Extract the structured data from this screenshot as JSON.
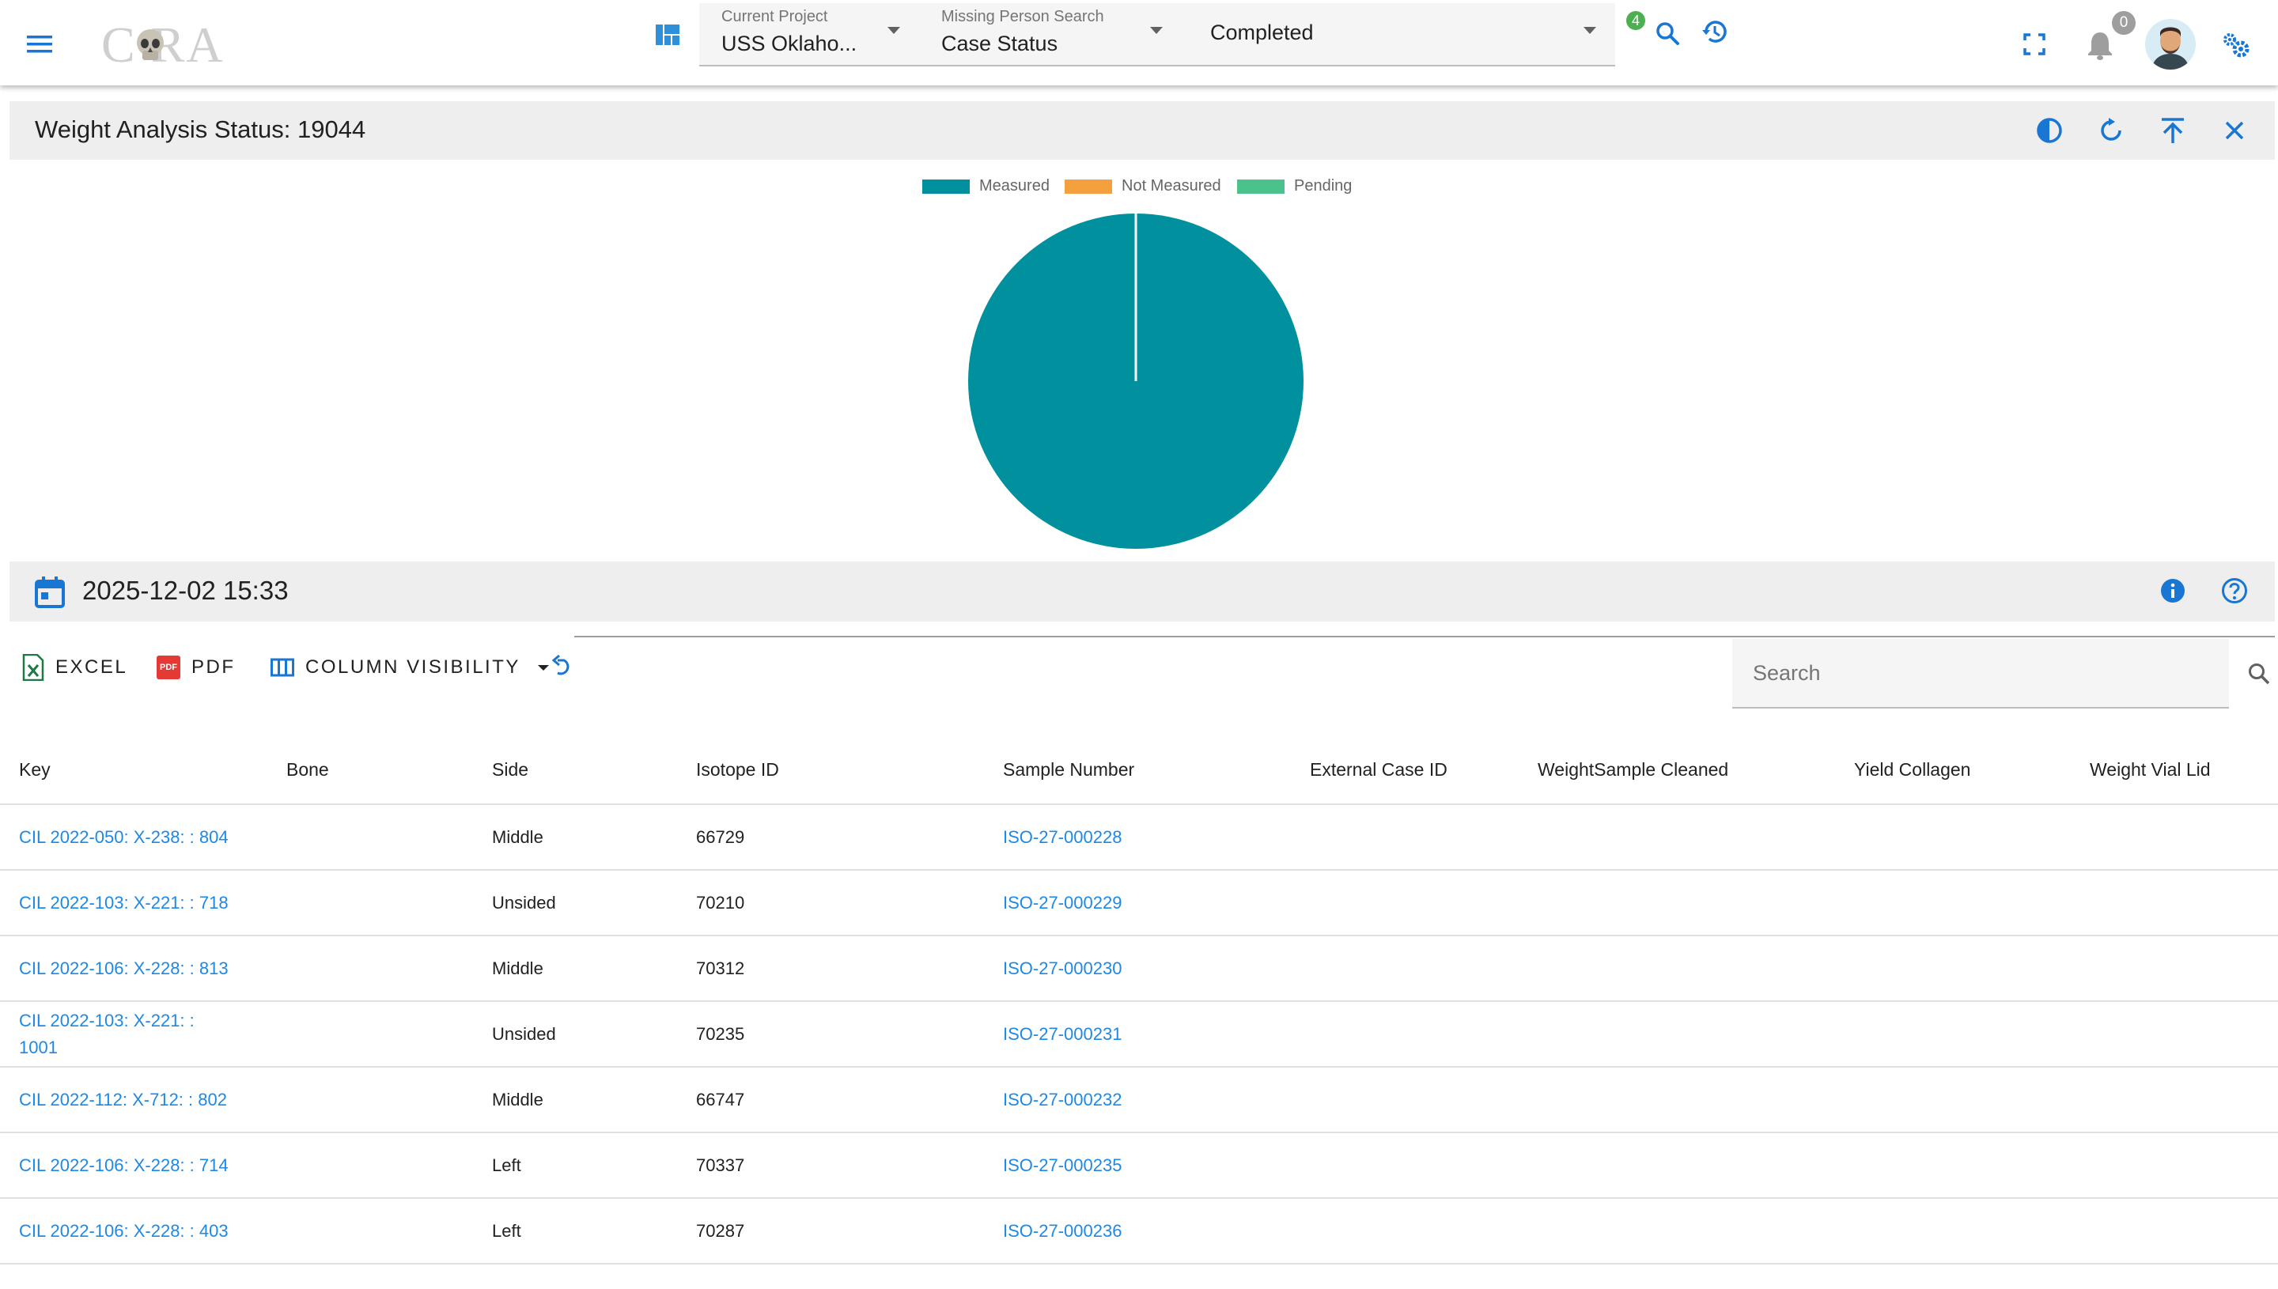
{
  "app": {
    "logo_text": "C RA",
    "colors": {
      "primary": "#1976d2",
      "teal": "#00909e",
      "orange": "#f5a03e",
      "green": "#4bc28c",
      "link": "#1e88e5"
    }
  },
  "topbar": {
    "current_project": {
      "label": "Current Project",
      "value": "USS Oklaho..."
    },
    "search_type": {
      "label": "Missing Person Search",
      "value": "Case Status"
    },
    "status_select": {
      "value": "Completed"
    },
    "search_badge": "4",
    "notification_count": "0"
  },
  "panel": {
    "title": "Weight Analysis Status: 19044"
  },
  "chart_data": {
    "type": "pie",
    "legend": [
      "Measured",
      "Not Measured",
      "Pending"
    ],
    "values": [
      19044,
      0,
      0
    ],
    "colors": [
      "#00909e",
      "#f5a03e",
      "#4bc28c"
    ],
    "legend_position": "top"
  },
  "date_bar": {
    "datetime": "2025-12-02 15:33"
  },
  "toolbar": {
    "excel_label": "EXCEL",
    "pdf_label": "PDF",
    "pdf_icon_text": "PDF",
    "column_visibility_label": "COLUMN VISIBILITY",
    "search_placeholder": "Search"
  },
  "table": {
    "columns": [
      "Key",
      "Bone",
      "Side",
      "Isotope ID",
      "Sample Number",
      "External Case ID",
      "WeightSample Cleaned",
      "Yield Collagen",
      "Weight Vial Lid"
    ],
    "rows": [
      {
        "key": "CIL 2022-050: X-238: : 804",
        "bone": "",
        "side": "Middle",
        "isotope": "66729",
        "sample": "ISO-27-000228"
      },
      {
        "key": "CIL 2022-103: X-221: : 718",
        "bone": "",
        "side": "Unsided",
        "isotope": "70210",
        "sample": "ISO-27-000229"
      },
      {
        "key": "CIL 2022-106: X-228: : 813",
        "bone": "",
        "side": "Middle",
        "isotope": "70312",
        "sample": "ISO-27-000230"
      },
      {
        "key": "CIL 2022-103: X-221: : 1001",
        "bone": "",
        "side": "Unsided",
        "isotope": "70235",
        "sample": "ISO-27-000231"
      },
      {
        "key": "CIL 2022-112: X-712: : 802",
        "bone": "",
        "side": "Middle",
        "isotope": "66747",
        "sample": "ISO-27-000232"
      },
      {
        "key": "CIL 2022-106: X-228: : 714",
        "bone": "",
        "side": "Left",
        "isotope": "70337",
        "sample": "ISO-27-000235"
      },
      {
        "key": "CIL 2022-106: X-228: : 403",
        "bone": "",
        "side": "Left",
        "isotope": "70287",
        "sample": "ISO-27-000236"
      }
    ]
  }
}
